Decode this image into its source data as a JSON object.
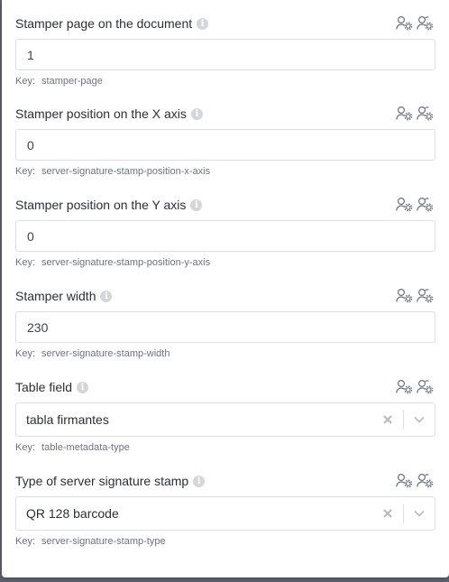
{
  "fields": [
    {
      "label": "Stamper page on the document",
      "value": "1",
      "key_label": "Key:",
      "key": "stamper-page"
    },
    {
      "label": "Stamper position on the X axis",
      "value": "0",
      "key_label": "Key:",
      "key": "server-signature-stamp-position-x-axis"
    },
    {
      "label": "Stamper position on the Y axis",
      "value": "0",
      "key_label": "Key:",
      "key": "server-signature-stamp-position-y-axis"
    },
    {
      "label": "Stamper width",
      "value": "230",
      "key_label": "Key:",
      "key": "server-signature-stamp-width"
    },
    {
      "label": "Table field",
      "value": "tabla firmantes",
      "key_label": "Key:",
      "key": "table-metadata-type"
    },
    {
      "label": "Type of server signature stamp",
      "value": "QR 128 barcode",
      "key_label": "Key:",
      "key": "server-signature-stamp-type"
    }
  ],
  "icons": {
    "info": "info-icon",
    "user_settings": "user-settings-icon",
    "group_settings": "group-settings-icon",
    "clear": "clear-icon",
    "chevron": "chevron-down-icon"
  },
  "colors": {
    "label": "#2b2f36",
    "key_text": "#6b7280",
    "border": "#dcdfe4",
    "icon": "#6b7280"
  }
}
